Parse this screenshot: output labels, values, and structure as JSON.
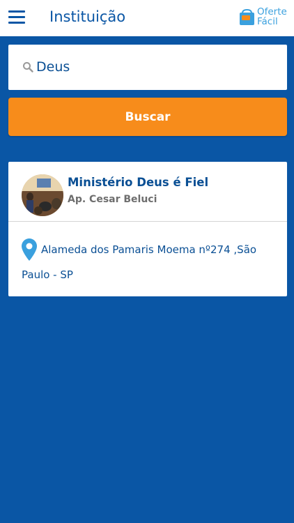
{
  "app_bar": {
    "title": "Instituição",
    "logo_text_line1": "Oferte",
    "logo_text_line2": "Fácil"
  },
  "search": {
    "value": "Deus",
    "button_label": "Buscar"
  },
  "results": [
    {
      "name": "Ministério Deus é Fiel",
      "leader": "Ap. Cesar Beluci",
      "address_line1": "Alameda dos Pamaris Moema nº274 ,São",
      "address_line2": "Paulo - SP"
    }
  ],
  "icons": {
    "menu": "hamburger-menu-icon",
    "search": "search-icon",
    "location": "map-pin-icon"
  },
  "colors": {
    "primary": "#0a56a5",
    "accent": "#f78c1b",
    "logo": "#3aa0de",
    "text_dark_blue": "#0a4f94",
    "subtitle_gray": "#6e6e6e"
  }
}
